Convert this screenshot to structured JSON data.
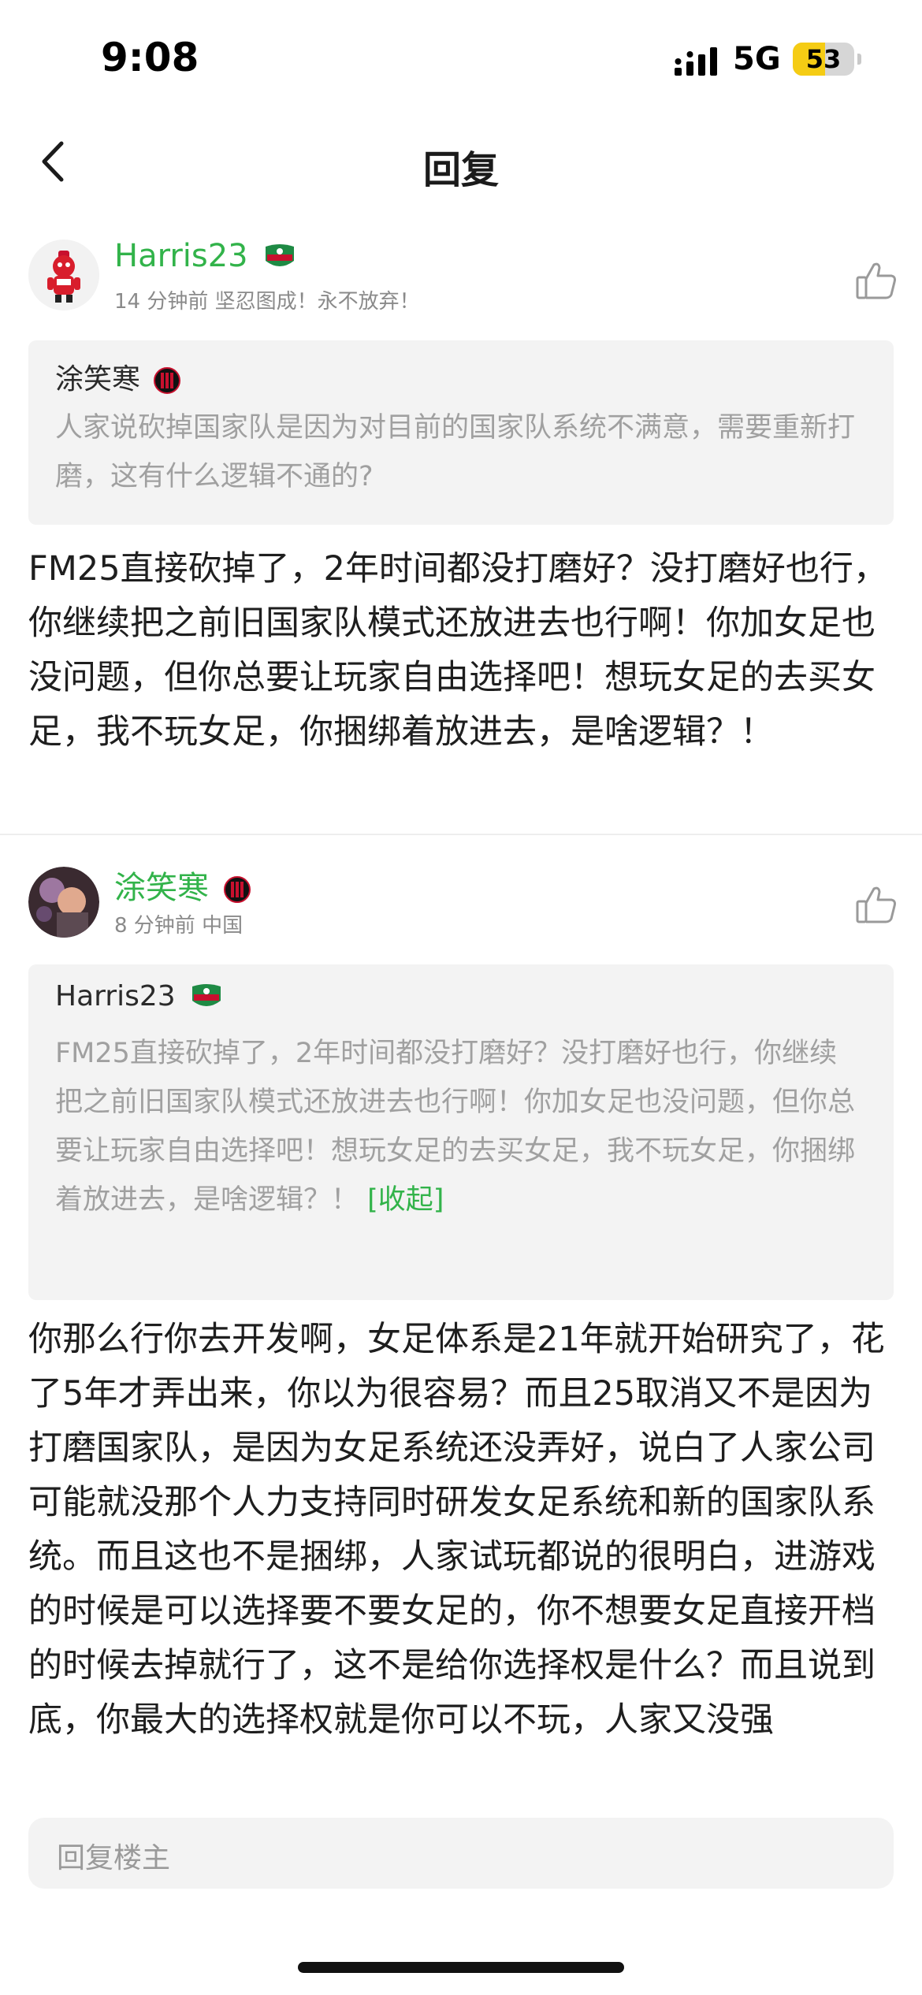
{
  "status_bar": {
    "time": "9:08",
    "network": "5G",
    "battery": "53",
    "battery_level": 0.53
  },
  "nav": {
    "title": "回复",
    "back_icon": "chevron-left-icon"
  },
  "comments": [
    {
      "username": "Harris23",
      "time": "14 分钟前",
      "signature": "坚忍图成！永不放弃！",
      "quote": {
        "username": "涂笑寒",
        "text": "人家说砍掉国家队是因为对目前的国家队系统不满意，需要重新打磨，这有什么逻辑不通的?"
      },
      "body": "FM25直接砍掉了，2年时间都没打磨好？没打磨好也行，你继续把之前旧国家队模式还放进去也行啊！你加女足也没问题，但你总要让玩家自由选择吧！想玩女足的去买女足，我不玩女足，你捆绑着放进去，是啥逻辑？！"
    },
    {
      "username": "涂笑寒",
      "time": "8 分钟前",
      "signature": "中国",
      "quote": {
        "username": "Harris23",
        "text": "FM25直接砍掉了，2年时间都没打磨好？没打磨好也行，你继续把之前旧国家队模式还放进去也行啊！你加女足也没问题，但你总要让玩家自由选择吧！想玩女足的去买女足，我不玩女足，你捆绑着放进去，是啥逻辑？！",
        "fold_label": "[收起]"
      },
      "body": "你那么行你去开发啊，女足体系是21年就开始研究了，花了5年才弄出来，你以为很容易？而且25取消又不是因为打磨国家队，是因为女足系统还没弄好，说白了人家公司可能就没那个人力支持同时研发女足系统和新的国家队系统。而且这也不是捆绑，人家试玩都说的很明白，进游戏的时候是可以选择要不要女足的，你不想要女足直接开档的时候去掉就行了，这不是给你选择权是什么？而且说到底，你最大的选择权就是你可以不玩，人家又没强"
    }
  ],
  "reply_box": {
    "placeholder": "回复楼主"
  },
  "colors": {
    "accent": "#32b34a",
    "quote_bg": "#f3f3f3",
    "battery": "#f5cc14"
  }
}
